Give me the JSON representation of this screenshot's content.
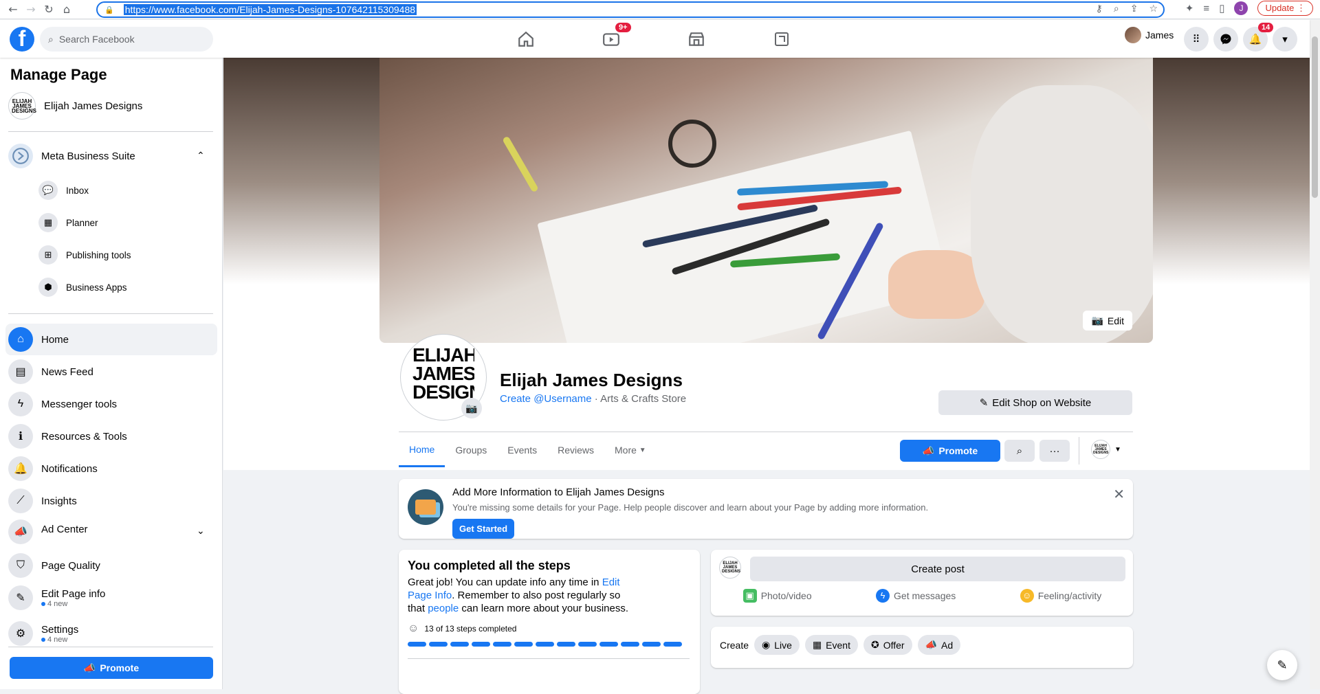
{
  "browser": {
    "url": "https://www.facebook.com/Elijah-James-Designs-107642115309488",
    "update_label": "Update",
    "profile_initial": "J"
  },
  "topbar": {
    "search_placeholder": "Search Facebook",
    "watch_badge": "9+",
    "user_name": "James",
    "notification_badge": "14"
  },
  "sidebar": {
    "title": "Manage Page",
    "page_name": "Elijah James Designs",
    "page_logo_text": "ELIJAH JAMES DESIGNS",
    "business_suite": "Meta Business Suite",
    "suite_items": [
      "Inbox",
      "Planner",
      "Publishing tools",
      "Business Apps"
    ],
    "nav": {
      "home": "Home",
      "news_feed": "News Feed",
      "messenger_tools": "Messenger tools",
      "resources_tools": "Resources & Tools",
      "notifications": "Notifications",
      "insights": "Insights",
      "ad_center": "Ad Center",
      "page_quality": "Page Quality",
      "edit_page_info": "Edit Page info",
      "edit_page_info_new": "4 new",
      "settings": "Settings",
      "settings_new": "4 new"
    },
    "promote_label": "Promote"
  },
  "page": {
    "cover_edit_label": "Edit",
    "profile_text": "ELIJAH JAMES DESIGNS",
    "name": "Elijah James Designs",
    "create_username": "Create @Username",
    "category": " · Arts & Crafts Store",
    "edit_shop_label": "Edit Shop on Website",
    "tabs": [
      "Home",
      "Groups",
      "Events",
      "Reviews",
      "More"
    ],
    "promote_label": "Promote"
  },
  "info_card": {
    "title": "Add More Information to Elijah James Designs",
    "description": "You're missing some details for your Page. Help people discover and learn about your Page by adding more information.",
    "button": "Get Started"
  },
  "steps_card": {
    "title": "You completed all the steps",
    "body_1": "Great job! You can update info any time in ",
    "link_1": "Edit Page Info",
    "body_2": ". Remember to also post regularly so that ",
    "link_2": "people",
    "body_3": " can learn more about your business.",
    "count": "13 of 13 steps completed",
    "completed": 13,
    "total": 13
  },
  "create_post": {
    "button": "Create post",
    "photo_video": "Photo/video",
    "get_messages": "Get messages",
    "feeling_activity": "Feeling/activity"
  },
  "create_row": {
    "label": "Create",
    "live": "Live",
    "event": "Event",
    "offer": "Offer",
    "ad": "Ad"
  }
}
